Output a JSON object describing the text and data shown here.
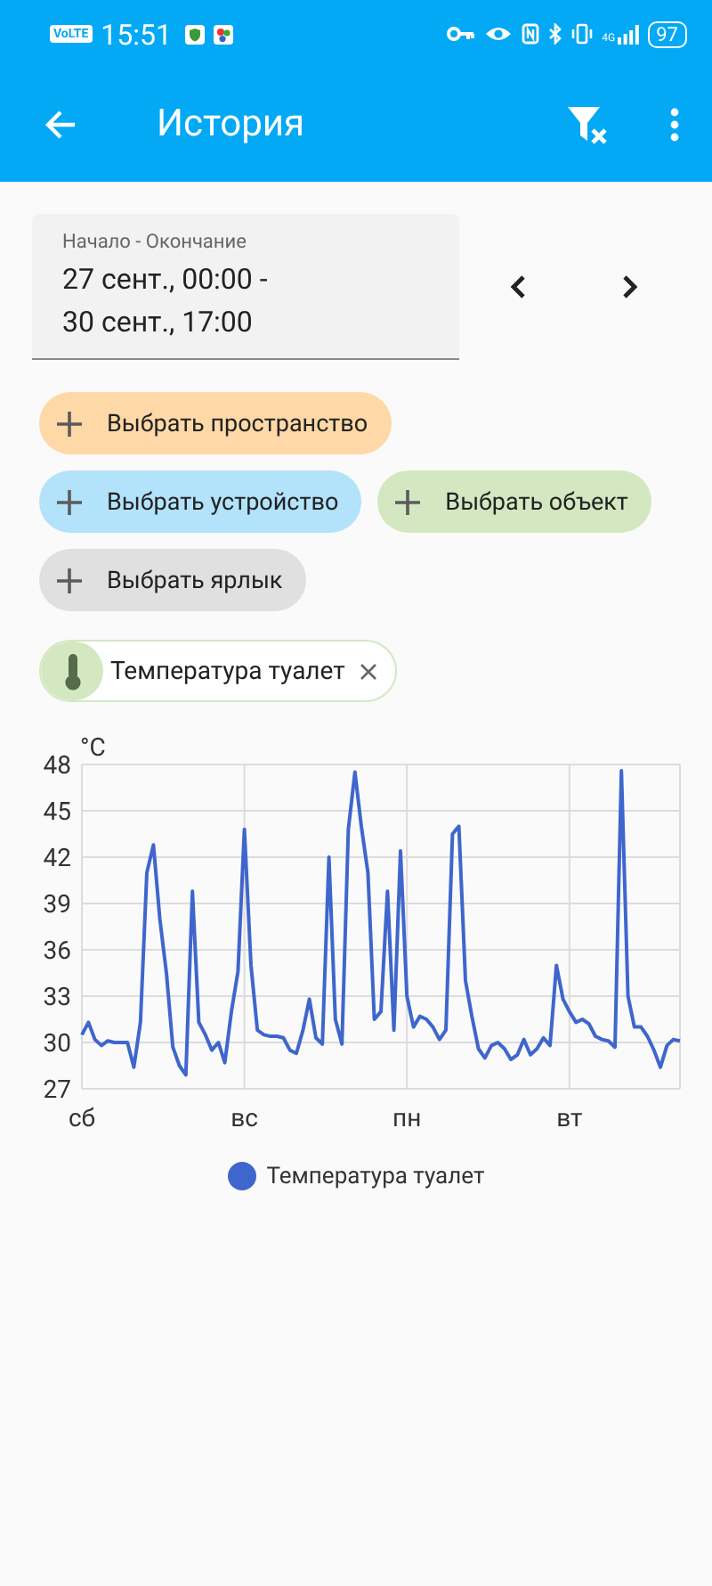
{
  "status_bar": {
    "network_badge": "VoLTE",
    "time": "15:51",
    "signal_badge": "4G",
    "battery": "97"
  },
  "app_bar": {
    "title": "История"
  },
  "date_range": {
    "label": "Начало - Окончание",
    "value_lines": [
      "27 сент., 00:00 -",
      "30 сент., 17:00"
    ]
  },
  "filter_chips": [
    {
      "label": "Выбрать пространство",
      "color": "#fed8a6"
    },
    {
      "label": "Выбрать устройство",
      "color": "#b3e2fb"
    },
    {
      "label": "Выбрать объект",
      "color": "#d3e8c0"
    },
    {
      "label": "Выбрать ярлык",
      "color": "#e0e0e0"
    }
  ],
  "selected_entities": [
    {
      "label": "Температура туалет",
      "color": "#d3e8c0"
    }
  ],
  "chart_data": {
    "type": "line",
    "ylabel": "°C",
    "ylim": [
      27,
      48
    ],
    "grid": true,
    "yticks": [
      27,
      30,
      33,
      36,
      39,
      42,
      45,
      48
    ],
    "categories": [
      "сб",
      null,
      null,
      null,
      null,
      null,
      null,
      null,
      null,
      null,
      null,
      null,
      null,
      null,
      null,
      null,
      null,
      null,
      null,
      null,
      null,
      null,
      null,
      null,
      null,
      "вс",
      null,
      null,
      null,
      null,
      null,
      null,
      null,
      null,
      null,
      null,
      null,
      null,
      null,
      null,
      null,
      null,
      null,
      null,
      null,
      null,
      null,
      null,
      null,
      null,
      "пн",
      null,
      null,
      null,
      null,
      null,
      null,
      null,
      null,
      null,
      null,
      null,
      null,
      null,
      null,
      null,
      null,
      null,
      null,
      null,
      null,
      null,
      null,
      null,
      null,
      "вт",
      null,
      null,
      null,
      null,
      null,
      null,
      null,
      null,
      null,
      null,
      null,
      null,
      null,
      null,
      null,
      null,
      null
    ],
    "series": [
      {
        "name": "Температура туалет",
        "color": "#3f66cc",
        "values": [
          30.5,
          31.3,
          30.2,
          29.8,
          30.1,
          30,
          30,
          30,
          28.4,
          31.3,
          41,
          42.8,
          38,
          34.5,
          29.7,
          28.5,
          27.9,
          39.8,
          31.3,
          30.5,
          29.5,
          30,
          28.7,
          32,
          34.6,
          43.8,
          35,
          30.8,
          30.5,
          30.4,
          30.4,
          30.3,
          29.5,
          29.3,
          30.8,
          32.8,
          30.3,
          29.9,
          42,
          31.5,
          29.9,
          43.8,
          47.5,
          44,
          41,
          31.5,
          32,
          39.8,
          30.8,
          42.4,
          33,
          31,
          31.7,
          31.5,
          31,
          30.2,
          30.8,
          43.5,
          44,
          34,
          31.7,
          29.6,
          29,
          29.8,
          30,
          29.6,
          28.9,
          29.2,
          30.2,
          29.2,
          29.6,
          30.3,
          29.8,
          35,
          32.8,
          32,
          31.3,
          31.5,
          31.2,
          30.4,
          30.2,
          30.1,
          29.7,
          47.6,
          33,
          31,
          31,
          30.4,
          29.5,
          28.4,
          29.8,
          30.2,
          30.1
        ]
      }
    ]
  }
}
